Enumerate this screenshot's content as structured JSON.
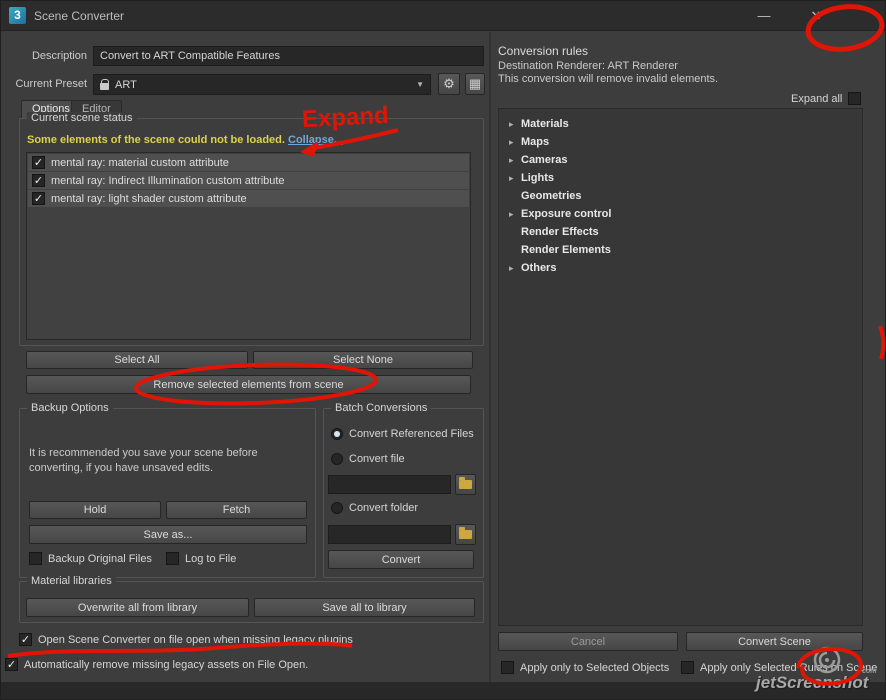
{
  "window": {
    "title": "Scene Converter",
    "app_icon": "3",
    "minimize_icon": "—",
    "close_icon": "✕"
  },
  "icons": {
    "gear": "⚙",
    "save_preset": "▦",
    "caret_down": "▼",
    "arrow_right": "▸",
    "check": "✓"
  },
  "header": {
    "description_label": "Description",
    "description_value": "Convert to ART Compatible Features",
    "preset_label": "Current Preset",
    "preset_value": "ART"
  },
  "tabs": {
    "options": "Options",
    "editor": "Editor"
  },
  "scene_status": {
    "group_label": "Current scene status",
    "warning": "Some elements of the scene could not be loaded.",
    "collapse_link": "Collapse...",
    "items": [
      {
        "label": "mental ray: material custom attribute",
        "checked": true
      },
      {
        "label": "mental ray: Indirect Illumination custom attribute",
        "checked": true
      },
      {
        "label": "mental ray: light shader custom attribute",
        "checked": true
      }
    ],
    "select_all_label": "Select All",
    "select_none_label": "Select None",
    "remove_button_label": "Remove selected elements from scene"
  },
  "backup_options": {
    "group_label": "Backup Options",
    "note": "It is recommended you save your scene before converting, if you have unsaved edits.",
    "hold_label": "Hold",
    "fetch_label": "Fetch",
    "save_as_label": "Save as...",
    "backup_original_label": "Backup Original Files",
    "log_to_file_label": "Log to File"
  },
  "batch_conversions": {
    "group_label": "Batch Conversions",
    "convert_referenced_label": "Convert Referenced Files",
    "convert_file_label": "Convert file",
    "file_path_value": "",
    "convert_folder_label": "Convert folder",
    "folder_path_value": "",
    "convert_label": "Convert"
  },
  "material_libraries": {
    "group_label": "Material libraries",
    "overwrite_label": "Overwrite all from library",
    "save_all_label": "Save all to library"
  },
  "footer": {
    "open_on_missing_label": "Open Scene Converter on file open when missing legacy plugins",
    "auto_remove_label": "Automatically remove missing legacy assets on File Open."
  },
  "conversion_rules": {
    "title": "Conversion rules",
    "destination": "Destination Renderer: ART Renderer",
    "note": "This conversion will remove invalid elements.",
    "expand_all_label": "Expand all",
    "tree": [
      {
        "label": "Materials",
        "expandable": true
      },
      {
        "label": "Maps",
        "expandable": true
      },
      {
        "label": "Cameras",
        "expandable": true
      },
      {
        "label": "Lights",
        "expandable": true
      },
      {
        "label": "Geometries",
        "expandable": false
      },
      {
        "label": "Exposure control",
        "expandable": true
      },
      {
        "label": "Render Effects",
        "expandable": false
      },
      {
        "label": "Render Elements",
        "expandable": false
      },
      {
        "label": "Others",
        "expandable": true
      }
    ],
    "cancel_label": "Cancel",
    "convert_scene_label": "Convert Scene",
    "apply_selected_objects_label": "Apply only to Selected Objects",
    "apply_selected_rules_label": "Apply only Selected Rules on Scene"
  },
  "annotations": {
    "expand_note": "Expand",
    "marker_color": "#e01505"
  },
  "watermark": {
    "text": "jetScreenshot",
    "suffix": "com"
  }
}
